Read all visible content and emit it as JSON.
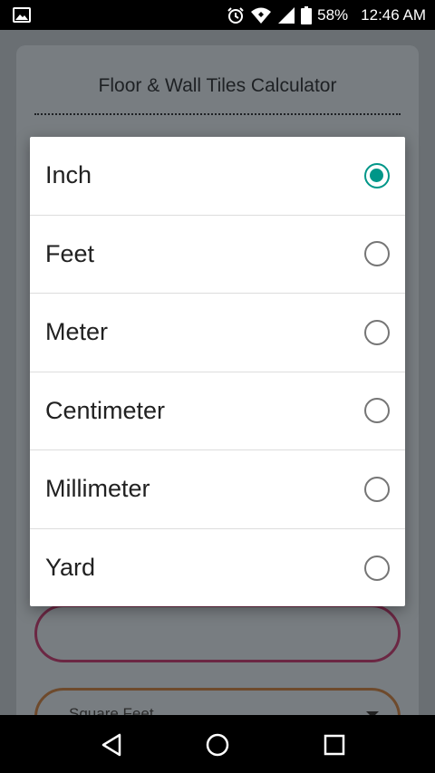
{
  "status_bar": {
    "battery": "58%",
    "time": "12:46 AM",
    "icons": [
      "image-icon",
      "alarm-icon",
      "wifi-icon",
      "signal-icon",
      "battery-icon"
    ]
  },
  "app": {
    "title": "Floor & Wall Tiles Calculator",
    "unit_select_value": "Square Feet"
  },
  "dialog": {
    "options": [
      {
        "label": "Inch",
        "selected": true
      },
      {
        "label": "Feet",
        "selected": false
      },
      {
        "label": "Meter",
        "selected": false
      },
      {
        "label": "Centimeter",
        "selected": false
      },
      {
        "label": "Millimeter",
        "selected": false
      },
      {
        "label": "Yard",
        "selected": false
      }
    ]
  },
  "colors": {
    "accent": "#009688",
    "radio_unselected": "#757575"
  },
  "nav": {
    "icons": [
      "back-icon",
      "home-icon",
      "recents-icon"
    ]
  }
}
